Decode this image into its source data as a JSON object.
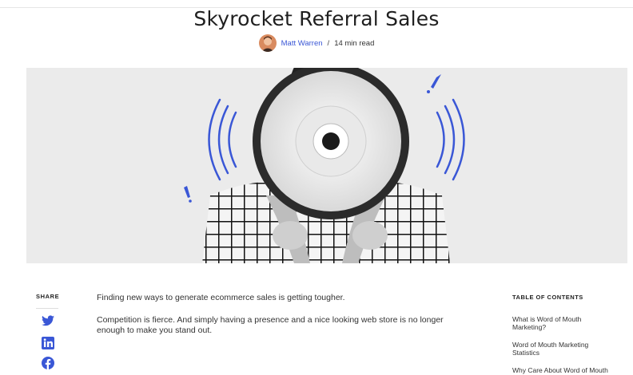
{
  "article": {
    "title": "Skyrocket Referral Sales",
    "author": "Matt Warren",
    "separator": "/",
    "read_time": "14 min read"
  },
  "share": {
    "label": "SHARE",
    "icons": [
      "twitter-icon",
      "linkedin-icon",
      "facebook-icon"
    ],
    "icon_color": "#3a57d6"
  },
  "body": {
    "paragraphs": [
      "Finding new ways to generate ecommerce sales is getting tougher.",
      "Competition is fierce. And simply having a presence and a nice looking web store is no longer enough to make you stand out."
    ]
  },
  "toc": {
    "title": "TABLE OF CONTENTS",
    "items": [
      "What is Word of Mouth Marketing?",
      "Word of Mouth Marketing Statistics",
      "Why Care About Word of Mouth"
    ]
  },
  "colors": {
    "accent": "#3a57d6",
    "title": "#1f1f1f"
  }
}
